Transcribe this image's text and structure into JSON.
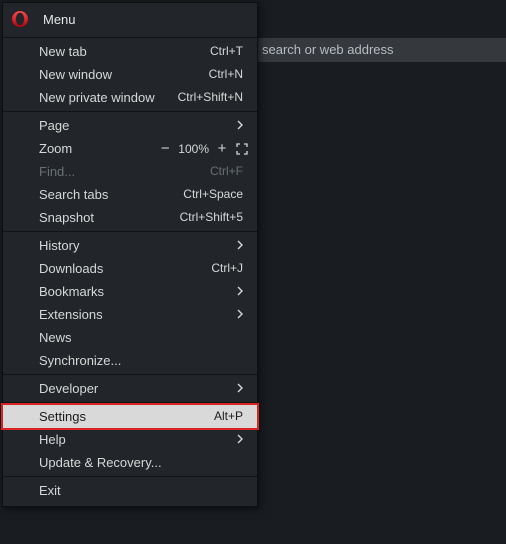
{
  "address_bar": {
    "placeholder_fragment": " search or web address"
  },
  "menu": {
    "title": "Menu",
    "items": {
      "new_tab": {
        "label": "New tab",
        "shortcut": "Ctrl+T"
      },
      "new_window": {
        "label": "New window",
        "shortcut": "Ctrl+N"
      },
      "new_private": {
        "label": "New private window",
        "shortcut": "Ctrl+Shift+N"
      },
      "page": {
        "label": "Page"
      },
      "zoom": {
        "label": "Zoom",
        "value": "100%"
      },
      "find": {
        "label": "Find...",
        "shortcut": "Ctrl+F"
      },
      "search_tabs": {
        "label": "Search tabs",
        "shortcut": "Ctrl+Space"
      },
      "snapshot": {
        "label": "Snapshot",
        "shortcut": "Ctrl+Shift+5"
      },
      "history": {
        "label": "History"
      },
      "downloads": {
        "label": "Downloads",
        "shortcut": "Ctrl+J"
      },
      "bookmarks": {
        "label": "Bookmarks"
      },
      "extensions": {
        "label": "Extensions"
      },
      "news": {
        "label": "News"
      },
      "synchronize": {
        "label": "Synchronize..."
      },
      "developer": {
        "label": "Developer"
      },
      "settings": {
        "label": "Settings",
        "shortcut": "Alt+P"
      },
      "help": {
        "label": "Help"
      },
      "update": {
        "label": "Update & Recovery..."
      },
      "exit": {
        "label": "Exit"
      }
    }
  }
}
